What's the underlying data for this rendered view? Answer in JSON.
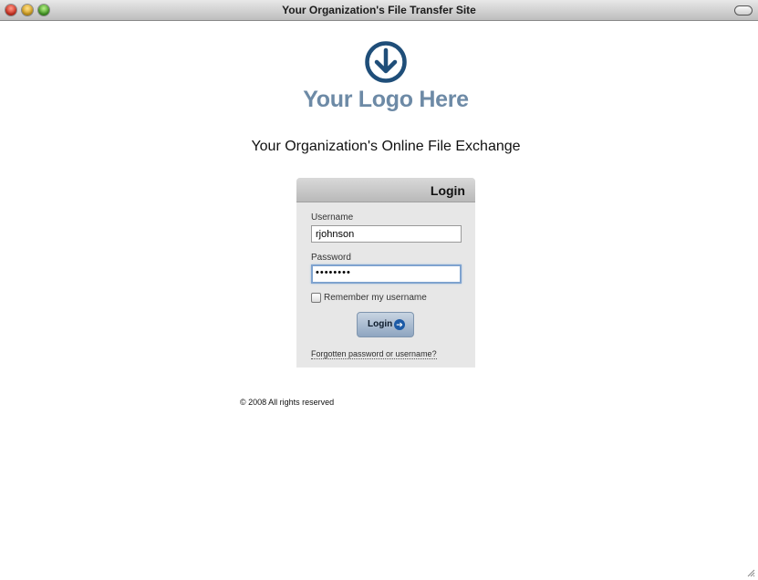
{
  "window": {
    "title": "Your Organization's File Transfer Site"
  },
  "logo": {
    "icon": "down-arrow-circle-icon",
    "text": "Your Logo Here",
    "color": "#6d8aa6",
    "icon_color": "#1f4e79"
  },
  "heading": "Your Organization's Online File Exchange",
  "login": {
    "title": "Login",
    "username_label": "Username",
    "username_value": "rjohnson",
    "password_label": "Password",
    "password_value": "••••••••",
    "remember_label": "Remember my username",
    "remember_checked": false,
    "button_label": "Login",
    "button_icon": "arrow-right-circle-icon",
    "forgot_link": "Forgotten password or username?"
  },
  "footer": {
    "copyright": "© 2008 All rights reserved"
  }
}
